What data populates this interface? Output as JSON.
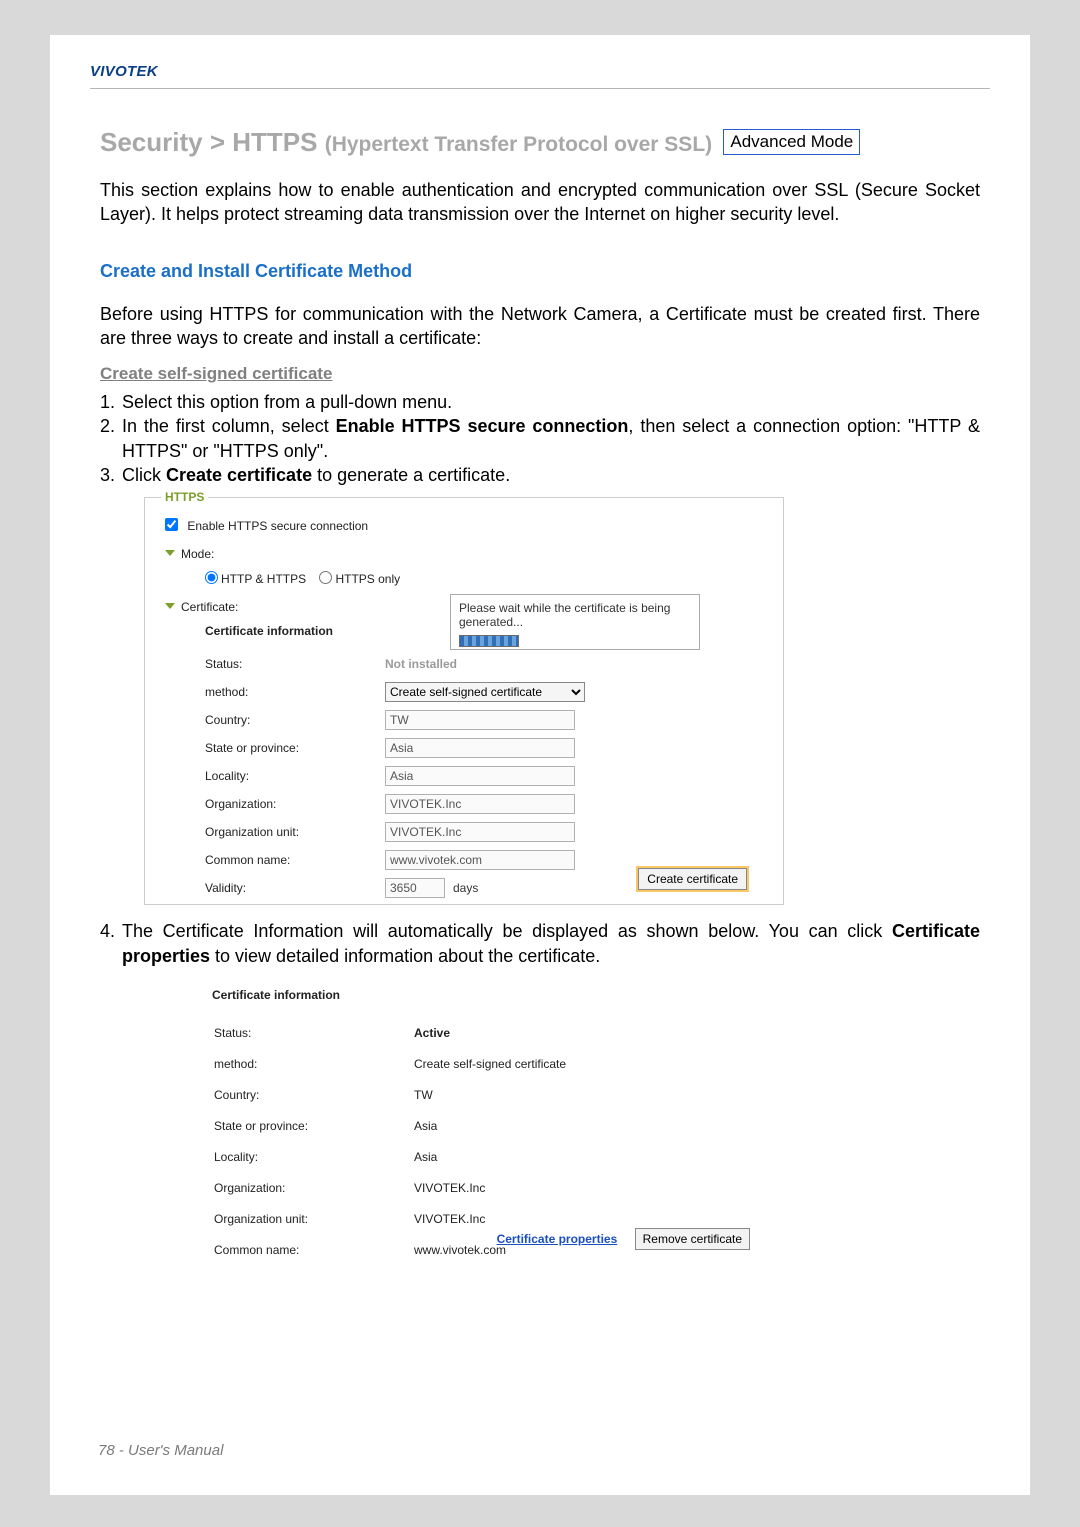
{
  "brand": "VIVOTEK",
  "heading": {
    "main": "Security >  HTTPS",
    "sub": "(Hypertext Transfer Protocol over SSL)",
    "badge": "Advanced Mode"
  },
  "intro": "This section explains how to enable authentication and encrypted communication over SSL (Secure Socket Layer). It helps protect streaming data transmission over the Internet on higher security level.",
  "h2": "Create and Install Certificate Method",
  "pre_steps": "Before using HTTPS for communication with the Network Camera, a Certificate must be created first. There are three ways to create and install a certificate:",
  "h3": "Create self-signed certificate",
  "steps": {
    "s1": "Select this option from a pull-down menu.",
    "s2a": "In the first column, select ",
    "s2b": "Enable HTTPS secure connection",
    "s2c": ", then select a connection option: \"HTTP & HTTPS\" or \"HTTPS only\".",
    "s3a": "Click ",
    "s3b": "Create certificate",
    "s3c": " to generate a certificate."
  },
  "shot1": {
    "fieldset_title": "HTTPS",
    "enable_label": "Enable HTTPS secure connection",
    "mode_label": "Mode:",
    "mode_opt1": "HTTP & HTTPS",
    "mode_opt2": "HTTPS only",
    "cert_label": "Certificate:",
    "cert_info_head": "Certificate information",
    "labels": {
      "status": "Status:",
      "method": "method:",
      "country": "Country:",
      "state": "State or province:",
      "locality": "Locality:",
      "org": "Organization:",
      "orgunit": "Organization unit:",
      "cn": "Common name:",
      "validity": "Validity:"
    },
    "values": {
      "status": "Not installed",
      "method": "Create self-signed certificate",
      "country": "TW",
      "state": "Asia",
      "locality": "Asia",
      "org": "VIVOTEK.Inc",
      "orgunit": "VIVOTEK.Inc",
      "cn": "www.vivotek.com",
      "validity": "3650",
      "days": "days"
    },
    "btn_create": "Create certificate",
    "wait_msg": "Please wait while the certificate is being generated..."
  },
  "step4": {
    "a": "The Certificate Information will automatically be displayed as shown below. You can click ",
    "b": "Certificate properties",
    "c": " to view detailed information about the certificate."
  },
  "shot2": {
    "cert_info_head": "Certificate information",
    "labels": {
      "status": "Status:",
      "method": "method:",
      "country": "Country:",
      "state": "State or province:",
      "locality": "Locality:",
      "org": "Organization:",
      "orgunit": "Organization unit:",
      "cn": "Common name:"
    },
    "values": {
      "status": "Active",
      "method": "Create self-signed certificate",
      "country": "TW",
      "state": "Asia",
      "locality": "Asia",
      "org": "VIVOTEK.Inc",
      "orgunit": "VIVOTEK.Inc",
      "cn": "www.vivotek.com"
    },
    "link_props": "Certificate properties",
    "btn_remove": "Remove certificate"
  },
  "footer": "78 - User's Manual"
}
